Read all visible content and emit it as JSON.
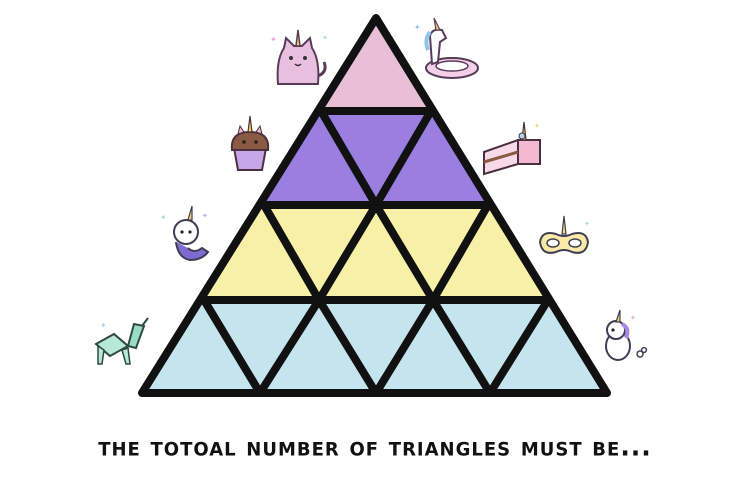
{
  "caption": {
    "text": "the totoal number of triangles must be..."
  },
  "colors": {
    "outline": "#111111",
    "row1": "#e8bfd6",
    "row2": "#9b7fe0",
    "row3": "#f8f0a6",
    "row4": "#c4e5ee"
  },
  "decorations": [
    {
      "icon": "unicorn-cat-icon"
    },
    {
      "icon": "unicorn-float-icon"
    },
    {
      "icon": "unicorn-cupcake-icon"
    },
    {
      "icon": "unicorn-cake-icon"
    },
    {
      "icon": "unicorn-mermaid-icon"
    },
    {
      "icon": "unicorn-mask-icon"
    },
    {
      "icon": "origami-unicorn-icon"
    },
    {
      "icon": "running-unicorn-icon"
    }
  ]
}
